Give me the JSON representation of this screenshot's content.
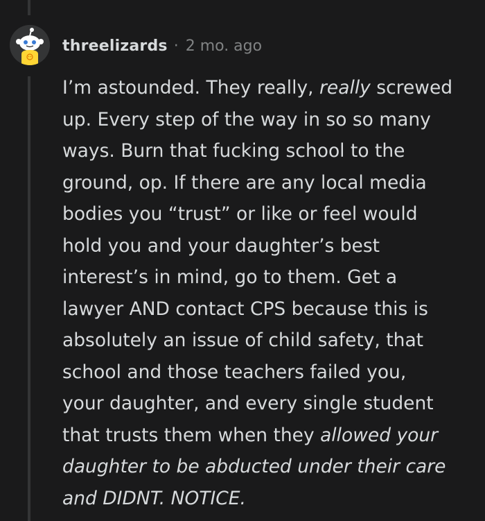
{
  "comment": {
    "username": "threelizards",
    "separator": "·",
    "time_ago": "2 mo. ago",
    "body_lines": [
      {
        "parts": [
          {
            "text": "I’m astounded. They really, ",
            "italic": false
          },
          {
            "text": "really",
            "italic": true
          },
          {
            "text": " screwed",
            "italic": false
          }
        ]
      },
      {
        "parts": [
          {
            "text": "up. Every step of the way in so so many",
            "italic": false
          }
        ]
      },
      {
        "parts": [
          {
            "text": "ways. Burn that fucking school to the",
            "italic": false
          }
        ]
      },
      {
        "parts": [
          {
            "text": "ground, op. If there are any local media",
            "italic": false
          }
        ]
      },
      {
        "parts": [
          {
            "text": "bodies you “trust” or like or feel would",
            "italic": false
          }
        ]
      },
      {
        "parts": [
          {
            "text": "hold you and your daughter’s best",
            "italic": false
          }
        ]
      },
      {
        "parts": [
          {
            "text": "interest’s in mind, go to them. Get a",
            "italic": false
          }
        ]
      },
      {
        "parts": [
          {
            "text": "lawyer AND contact CPS because this is",
            "italic": false
          }
        ]
      },
      {
        "parts": [
          {
            "text": "absolutely an issue of child safety, that",
            "italic": false
          }
        ]
      },
      {
        "parts": [
          {
            "text": "school and those teachers failed you,",
            "italic": false
          }
        ]
      },
      {
        "parts": [
          {
            "text": "your daughter, and every single student",
            "italic": false
          }
        ]
      },
      {
        "parts": [
          {
            "text": "that trusts them when they ",
            "italic": false
          },
          {
            "text": "allowed your",
            "italic": true
          }
        ]
      },
      {
        "parts": [
          {
            "text": "daughter to be abducted under their care",
            "italic": true
          }
        ]
      },
      {
        "parts": [
          {
            "text": "and DIDNT. NOTICE.",
            "italic": true
          }
        ]
      }
    ]
  },
  "avatar": {
    "icon": "snoo-avatar-icon",
    "background_color": "#343536",
    "shirt_color": "#ffd635"
  },
  "colors": {
    "background": "#1a1a1b",
    "text": "#d7dadc",
    "meta": "#818384",
    "thread_line": "#343536"
  }
}
